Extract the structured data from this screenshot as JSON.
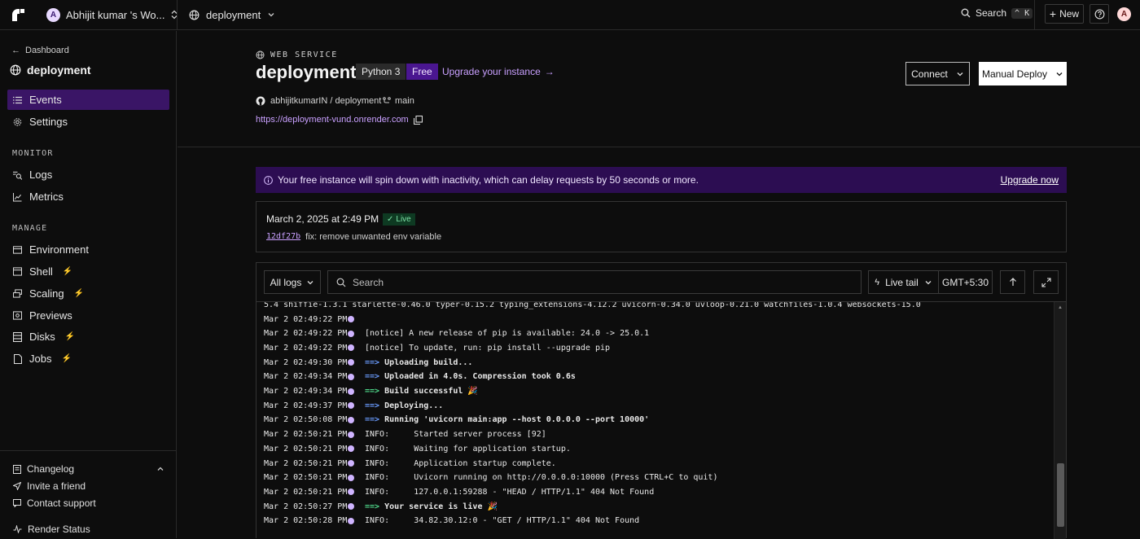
{
  "topbar": {
    "workspace_initial": "A",
    "workspace_name": "Abhijit kumar 's Wo...",
    "project_name": "deployment",
    "search_label": "Search",
    "search_kbd_ctrl": "^",
    "search_kbd_key": "K",
    "new_label": "New",
    "user_initial": "A"
  },
  "sidebar": {
    "back_label": "Dashboard",
    "service_name": "deployment",
    "nav": [
      {
        "label": "Events",
        "active": true
      },
      {
        "label": "Settings"
      }
    ],
    "monitor_heading": "MONITOR",
    "monitor": [
      {
        "label": "Logs"
      },
      {
        "label": "Metrics"
      }
    ],
    "manage_heading": "MANAGE",
    "manage": [
      {
        "label": "Environment"
      },
      {
        "label": "Shell"
      },
      {
        "label": "Scaling"
      },
      {
        "label": "Previews"
      },
      {
        "label": "Disks"
      },
      {
        "label": "Jobs"
      }
    ],
    "footer": [
      {
        "label": "Changelog"
      },
      {
        "label": "Invite a friend"
      },
      {
        "label": "Contact support"
      },
      {
        "label": "Render Status"
      }
    ]
  },
  "service": {
    "type_label": "WEB SERVICE",
    "title": "deployment",
    "runtime_badge": "Python 3",
    "plan_badge": "Free",
    "upgrade_link": "Upgrade your instance",
    "connect_label": "Connect",
    "manual_deploy_label": "Manual Deploy",
    "repo": "abhijitkumarIN / deployment",
    "branch": "main",
    "url": "https://deployment-vund.onrender.com"
  },
  "banner": {
    "text": "Your free instance will spin down with inactivity, which can delay requests by 50 seconds or more.",
    "link": "Upgrade now"
  },
  "deploy": {
    "date": "March 2, 2025 at 2:49 PM",
    "status": "Live",
    "commit_hash": "12df27b",
    "commit_message": "fix: remove unwanted env variable"
  },
  "logs": {
    "filter_label": "All logs",
    "search_placeholder": "Search",
    "live_tail_label": "Live tail",
    "timezone": "GMT+5:30",
    "truncated_line": "5.4 shiffie-1.3.1 starlette-0.46.0 typer-0.15.2 typing_extensions-4.12.2 uvicorn-0.34.0 uvloop-0.21.0 watchfiles-1.0.4 websockets-15.0",
    "lines": [
      {
        "ts": "Mar 2 02:49:22 PM",
        "msg": ""
      },
      {
        "ts": "Mar 2 02:49:22 PM",
        "msg": "[notice] A new release of pip is available: 24.0 -> 25.0.1"
      },
      {
        "ts": "Mar 2 02:49:22 PM",
        "msg": "[notice] To update, run: pip install --upgrade pip"
      },
      {
        "ts": "Mar 2 02:49:30 PM",
        "arrow": "==>",
        "msg": "Uploading build..."
      },
      {
        "ts": "Mar 2 02:49:34 PM",
        "arrow": "==>",
        "msg": "Uploaded in 4.0s. Compression took 0.6s"
      },
      {
        "ts": "Mar 2 02:49:34 PM",
        "arrow": "==>",
        "green": true,
        "msg": "Build successful 🎉"
      },
      {
        "ts": "Mar 2 02:49:37 PM",
        "arrow": "==>",
        "msg": "Deploying..."
      },
      {
        "ts": "Mar 2 02:50:08 PM",
        "arrow": "==>",
        "msg": "Running 'uvicorn main:app --host 0.0.0.0 --port 10000'"
      },
      {
        "ts": "Mar 2 02:50:21 PM",
        "msg": "INFO:     Started server process [92]"
      },
      {
        "ts": "Mar 2 02:50:21 PM",
        "msg": "INFO:     Waiting for application startup."
      },
      {
        "ts": "Mar 2 02:50:21 PM",
        "msg": "INFO:     Application startup complete."
      },
      {
        "ts": "Mar 2 02:50:21 PM",
        "msg": "INFO:     Uvicorn running on http://0.0.0.0:10000 (Press CTRL+C to quit)"
      },
      {
        "ts": "Mar 2 02:50:21 PM",
        "msg": "INFO:     127.0.0.1:59288 - \"HEAD / HTTP/1.1\" 404 Not Found"
      },
      {
        "ts": "Mar 2 02:50:27 PM",
        "arrow": "==>",
        "green": true,
        "msg": "Your service is live 🎉"
      },
      {
        "ts": "Mar 2 02:50:28 PM",
        "msg": "INFO:     34.82.30.12:0 - \"GET / HTTP/1.1\" 404 Not Found"
      }
    ]
  },
  "colors": {
    "accent_purple": "#4a1690",
    "banner_bg": "#2c0d52",
    "link_purple": "#c9a0ff",
    "live_green": "#7ee3a7"
  }
}
